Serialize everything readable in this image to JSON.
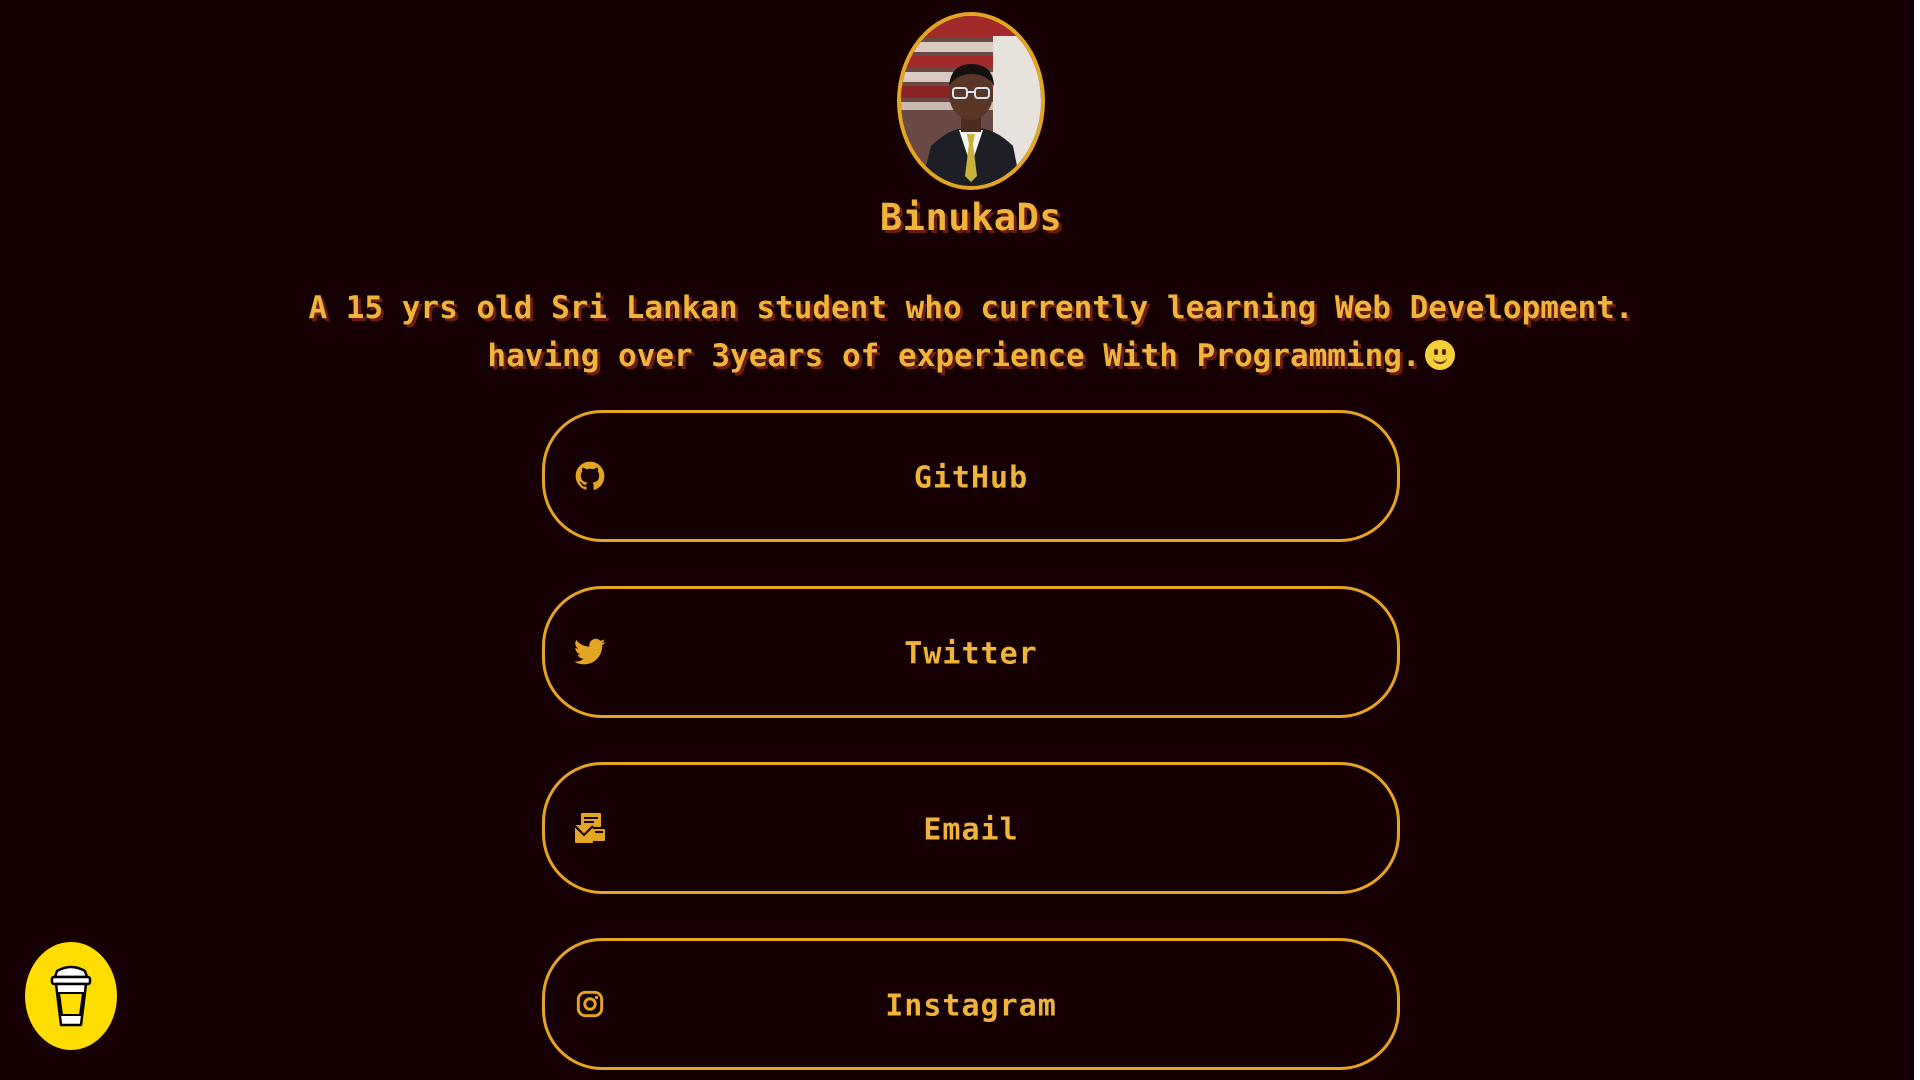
{
  "profile": {
    "username": "BinukaDs",
    "bio_line1": "A 15 yrs old Sri Lankan student who currently learning Web Development.",
    "bio_line2": "having over 3years of experience With Programming."
  },
  "links": [
    {
      "label": "GitHub",
      "icon": "github-icon"
    },
    {
      "label": "Twitter",
      "icon": "twitter-icon"
    },
    {
      "label": "Email",
      "icon": "email-icon"
    },
    {
      "label": "Instagram",
      "icon": "instagram-icon"
    }
  ],
  "buy_me_a_coffee": {
    "icon": "coffee-cup-icon"
  },
  "colors": {
    "background": "#170003",
    "accent": "#e4a622",
    "text": "#f0b43a",
    "text_shadow": "#6a1c12",
    "coffee_bg": "#ffdd00"
  }
}
